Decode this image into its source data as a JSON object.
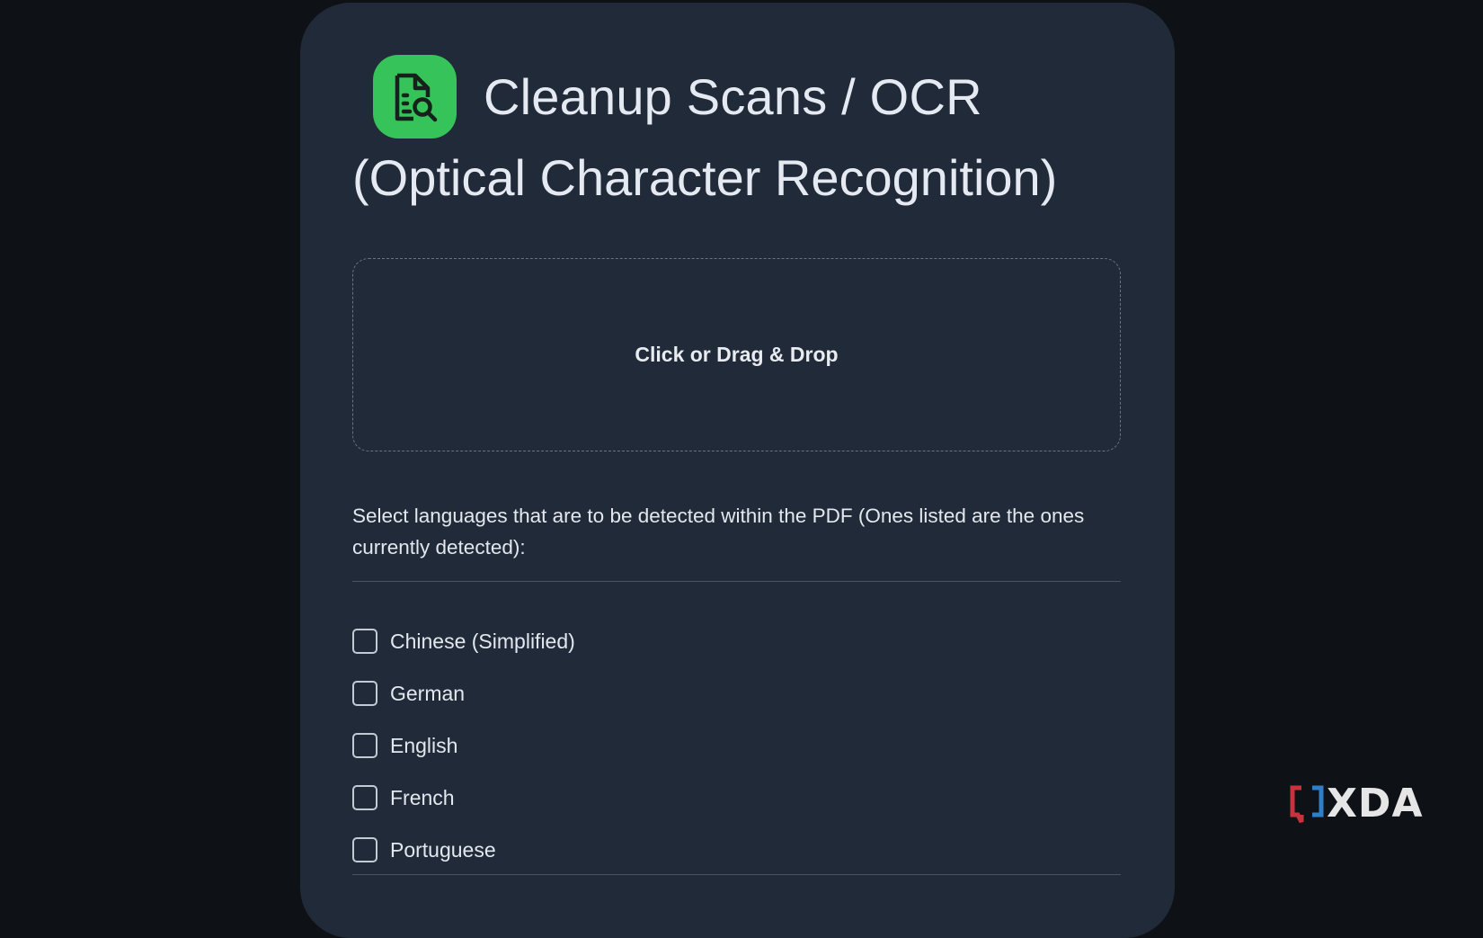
{
  "header": {
    "icon": "document-search-icon",
    "title_line1": "Cleanup Scans / OCR",
    "title_line2": "(Optical Character Recognition)"
  },
  "dropzone": {
    "label": "Click or Drag & Drop"
  },
  "instructions": "Select languages that are to be detected within the PDF (Ones listed are the ones currently detected):",
  "languages": [
    {
      "label": "Chinese (Simplified)",
      "checked": false
    },
    {
      "label": "German",
      "checked": false
    },
    {
      "label": "English",
      "checked": false
    },
    {
      "label": "French",
      "checked": false
    },
    {
      "label": "Portuguese",
      "checked": false
    }
  ],
  "watermark": {
    "text": "XDA"
  },
  "colors": {
    "background": "#0e1216",
    "card": "#212a38",
    "accent": "#35c35a"
  }
}
